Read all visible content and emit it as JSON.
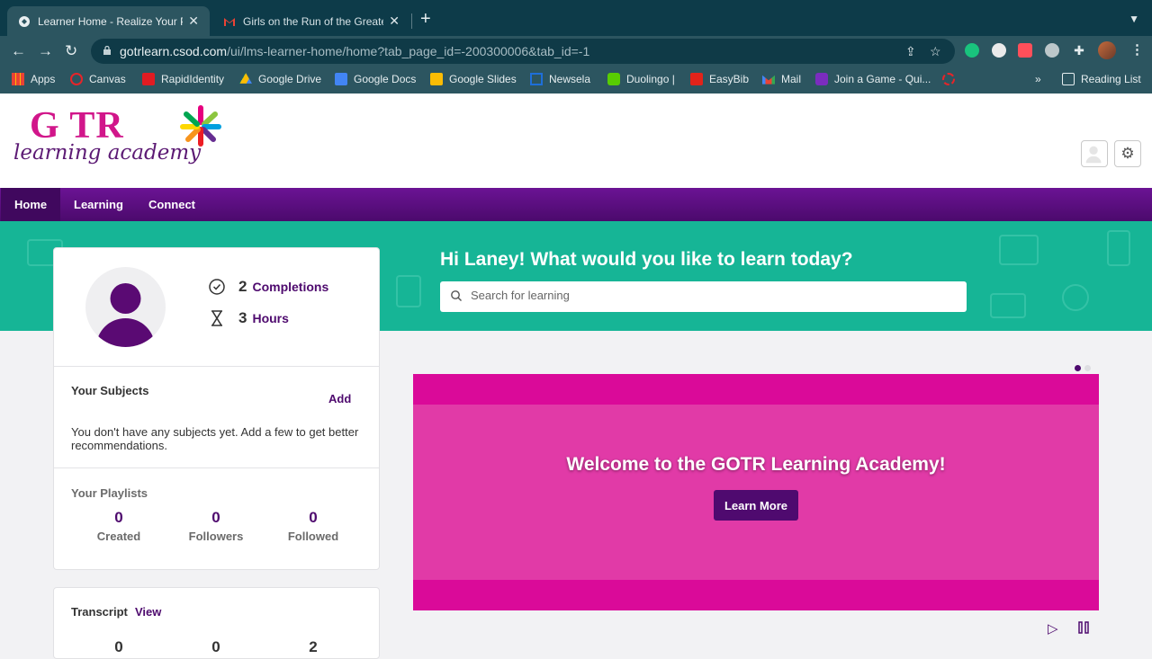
{
  "browser": {
    "tabs": [
      {
        "title": "Learner Home - Realize Your P",
        "active": true
      },
      {
        "title": "Girls on the Run of the Greater",
        "active": false
      }
    ],
    "url_host": "gotrlearn.csod.com",
    "url_path": "/ui/lms-learner-home/home?tab_page_id=-200300006&tab_id=-1",
    "bookmarks": [
      "Apps",
      "Canvas",
      "RapidIdentity",
      "Google Drive",
      "Google Docs",
      "Google Slides",
      "Newsela",
      "Duolingo |",
      "EasyBib",
      "Mail",
      "Join a Game - Qui..."
    ],
    "overflow": "»",
    "reading_list": "Reading List"
  },
  "logo": {
    "top": "G TR",
    "bottom": "learning academy"
  },
  "nav": {
    "home": "Home",
    "learning": "Learning",
    "connect": "Connect"
  },
  "hero": {
    "greeting": "Hi Laney! What would you like to learn today?",
    "search_placeholder": "Search for learning"
  },
  "profile": {
    "completions_count": "2",
    "completions_label": "Completions",
    "hours_count": "3",
    "hours_label": "Hours"
  },
  "subjects": {
    "title": "Your Subjects",
    "add": "Add",
    "empty_text": "You don't have any subjects yet. Add a few to get better recommendations."
  },
  "playlists": {
    "title": "Your Playlists",
    "created_count": "0",
    "created_label": "Created",
    "followers_count": "0",
    "followers_label": "Followers",
    "followed_count": "0",
    "followed_label": "Followed"
  },
  "transcript": {
    "title": "Transcript",
    "view": "View",
    "values": [
      "0",
      "0",
      "2"
    ]
  },
  "banner": {
    "title": "Welcome to the GOTR Learning Academy!",
    "button": "Learn More"
  },
  "colors": {
    "purple": "#4e0a6e",
    "teal": "#16b596",
    "pink": "#e13aa7",
    "magenta": "#da0a99"
  }
}
